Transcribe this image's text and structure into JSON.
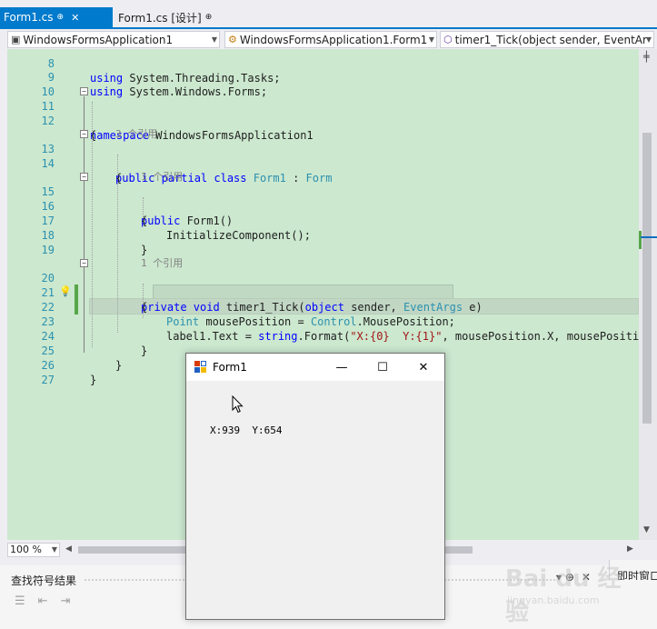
{
  "tabs": [
    {
      "label": "Form1.cs",
      "active": true,
      "pin_glyph": "⊕",
      "close_glyph": "✕"
    },
    {
      "label": "Form1.cs [设计]",
      "active": false,
      "pin_glyph": "⊕"
    }
  ],
  "navbar": {
    "project": "WindowsFormsApplication1",
    "class": "WindowsFormsApplication1.Form1",
    "member": "timer1_Tick(object sender, EventAr"
  },
  "code": {
    "lines": [
      {
        "n": "8",
        "text": "using System.Threading.Tasks;"
      },
      {
        "n": "9",
        "text": "using System.Windows.Forms;"
      },
      {
        "n": "10",
        "text": ""
      },
      {
        "n": "11",
        "text": "namespace WindowsFormsApplication1"
      },
      {
        "n": "12",
        "text": "{"
      },
      {
        "n": "",
        "text": "3 个引用"
      },
      {
        "n": "13",
        "text": "public partial class Form1 : Form"
      },
      {
        "n": "14",
        "text": "{"
      },
      {
        "n": "",
        "text": "1 个引用"
      },
      {
        "n": "15",
        "text": "public Form1()"
      },
      {
        "n": "16",
        "text": "{"
      },
      {
        "n": "17",
        "text": "InitializeComponent();"
      },
      {
        "n": "18",
        "text": "}"
      },
      {
        "n": "19",
        "text": ""
      },
      {
        "n": "",
        "text": "1 个引用"
      },
      {
        "n": "20",
        "text": "private void timer1_Tick(object sender, EventArgs e)"
      },
      {
        "n": "21",
        "text": "{"
      },
      {
        "n": "22",
        "text": "Point mousePosition = Control.MousePosition;"
      },
      {
        "n": "23",
        "text": "label1.Text = string.Format(\"X:{0}  Y:{1}\", mousePosition.X, mousePosition."
      },
      {
        "n": "24",
        "text": "}"
      },
      {
        "n": "25",
        "text": "}"
      },
      {
        "n": "26",
        "text": "}"
      },
      {
        "n": "27",
        "text": ""
      }
    ]
  },
  "statusbar": {
    "zoom": "100 %"
  },
  "bottom_panel": {
    "title": "查找符号结果",
    "pin": "▾ ⊕",
    "close": "✕",
    "side_label": "即时窗口"
  },
  "form1": {
    "title": "Form1",
    "label_text": "X:939  Y:654",
    "min_glyph": "—",
    "max_glyph": "☐",
    "close_glyph": "✕"
  },
  "watermark": {
    "logo": "Bai du 经验",
    "url": "jingyan.baidu.com"
  },
  "colors": {
    "editor_bg": "#cce8cf",
    "accent": "#007acc",
    "keyword": "#0000ff",
    "type": "#2b91af",
    "string": "#a31515"
  }
}
